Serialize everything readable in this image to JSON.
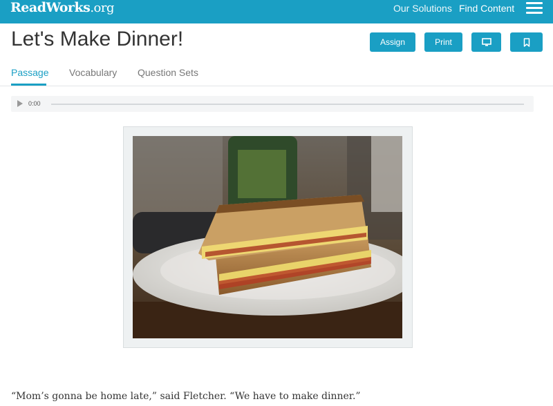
{
  "header": {
    "logo_main": "ReadWorks",
    "logo_suffix": ".org",
    "nav": [
      {
        "label": "Our Solutions"
      },
      {
        "label": "Find Content"
      }
    ],
    "menu_icon": "hamburger-menu-icon"
  },
  "page": {
    "title": "Let's Make Dinner!"
  },
  "actions": {
    "assign_label": "Assign",
    "print_label": "Print",
    "present_icon": "monitor-icon",
    "bookmark_icon": "bookmark-icon"
  },
  "tabs": [
    {
      "label": "Passage",
      "active": true
    },
    {
      "label": "Vocabulary",
      "active": false
    },
    {
      "label": "Question Sets",
      "active": false
    }
  ],
  "audio": {
    "time": "0:00",
    "play_icon": "play-icon",
    "progress": 0
  },
  "passage": {
    "image_subject": "grilled cheese sandwich on a plate",
    "first_line": "“Mom’s gonna be home late,” said Fletcher. “We have to make dinner.”"
  },
  "colors": {
    "brand": "#1a9fc4",
    "title_text": "#333333",
    "tab_inactive": "#777777"
  }
}
